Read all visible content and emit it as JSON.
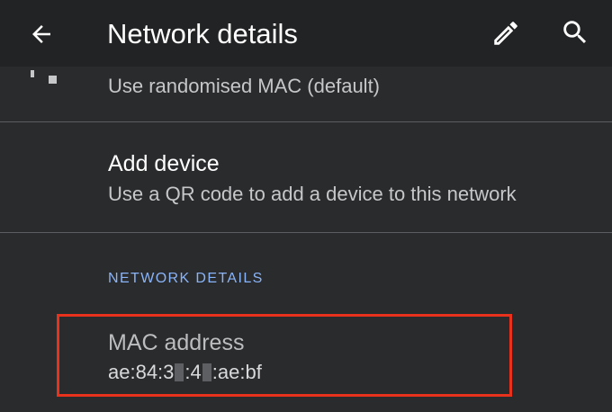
{
  "appbar": {
    "title": "Network details",
    "back_icon": "arrow-left-icon",
    "edit_icon": "pencil-icon",
    "search_icon": "search-icon"
  },
  "privacy_row": {
    "summary": "Use randomised MAC (default)"
  },
  "add_device": {
    "title": "Add device",
    "summary": "Use a QR code to add a device to this network"
  },
  "section": {
    "header": "NETWORK DETAILS"
  },
  "mac": {
    "title": "MAC address",
    "value_part1": "ae:84:3",
    "value_part2": ":4",
    "value_part3": ":ae:bf"
  },
  "colors": {
    "background": "#2a2b2d",
    "appbar": "#222324",
    "section_header": "#8ab4f8",
    "highlight": "#e8321b"
  }
}
